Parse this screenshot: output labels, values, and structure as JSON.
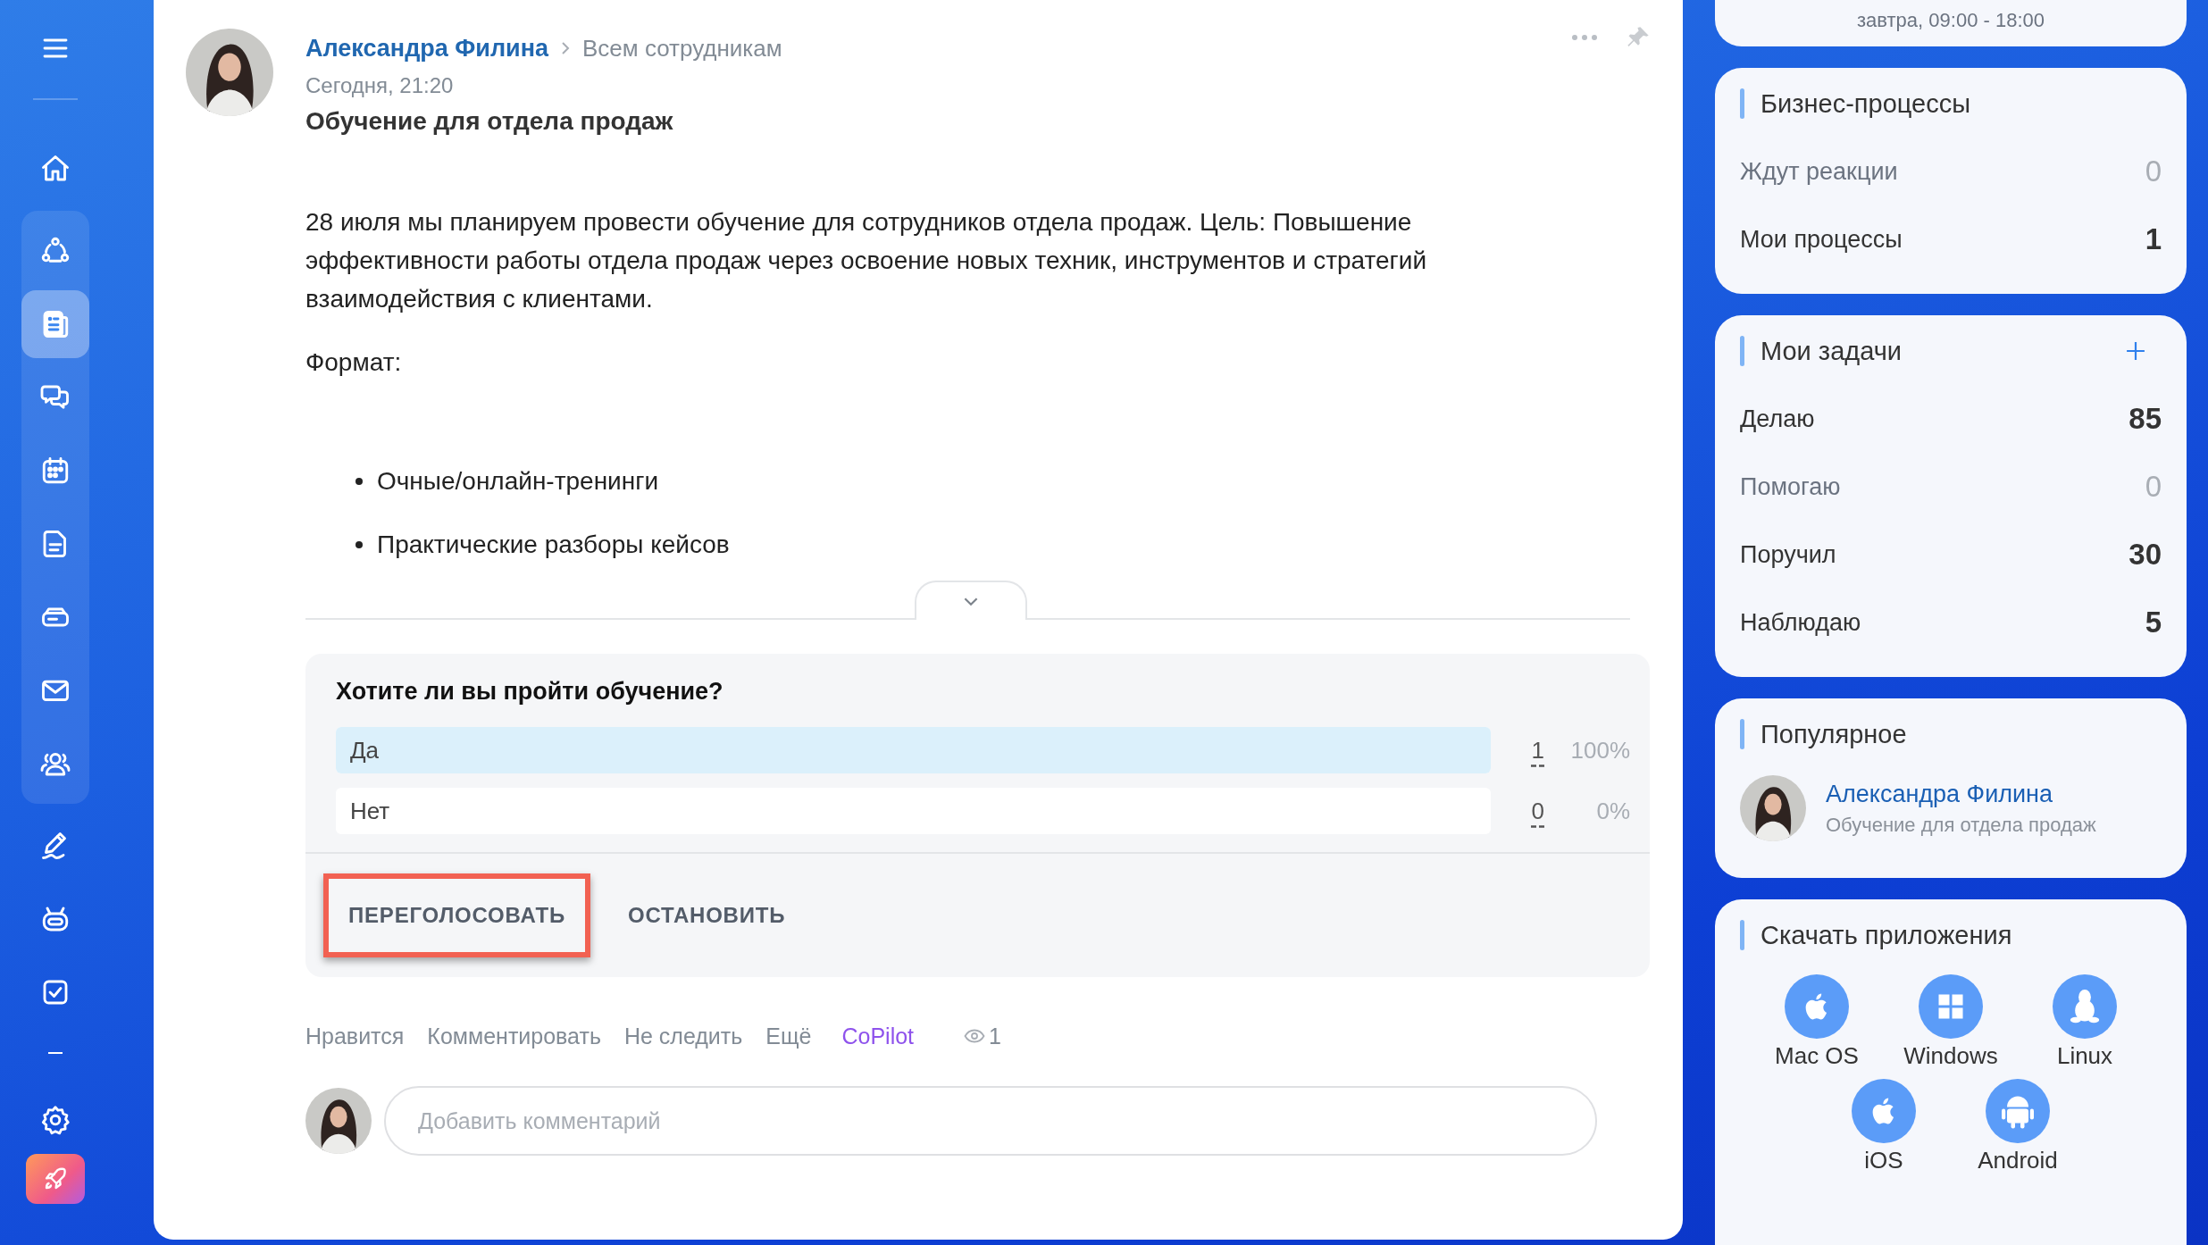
{
  "sidebar": {
    "items_before": [
      {
        "selected": false
      }
    ],
    "group": [
      {
        "selected": false
      },
      {
        "selected": true
      },
      {
        "selected": false
      },
      {
        "selected": false
      },
      {
        "selected": false
      },
      {
        "selected": false
      },
      {
        "selected": false
      },
      {
        "selected": false
      }
    ],
    "items_after": [
      {
        "selected": false
      },
      {
        "selected": false
      },
      {
        "selected": false
      }
    ]
  },
  "post": {
    "author": "Александра Филина",
    "audience": "Всем сотрудникам",
    "time": "Сегодня, 21:20",
    "title": "Обучение для отдела продаж",
    "paragraphs": [
      "28 июля мы планируем провести обучение для сотрудников отдела продаж. Цель: Повышение эффективности работы отдела продаж через освоение новых техник, инструментов и стратегий взаимодействия с клиентами.",
      "Формат:"
    ],
    "bullets": [
      "Очные/онлайн-тренинги",
      "Практические разборы кейсов"
    ],
    "poll": {
      "question": "Хотите ли вы пройти обучение?",
      "options": [
        {
          "label": "Да",
          "votes": "1",
          "percent": "100%",
          "level": 1
        },
        {
          "label": "Нет",
          "votes": "0",
          "percent": "0%",
          "level": 0
        }
      ],
      "buttons": [
        {
          "label": "ПЕРЕГОЛОСОВАТЬ",
          "highlighted": true
        },
        {
          "label": "ОСТАНОВИТЬ",
          "highlighted": false
        }
      ]
    },
    "actions": [
      {
        "label": "Нравится",
        "kind": "plain"
      },
      {
        "label": "Комментировать",
        "kind": "plain"
      },
      {
        "label": "Не следить",
        "kind": "plain"
      },
      {
        "label": "Ещё",
        "kind": "plain"
      },
      {
        "label": "CoPilot",
        "kind": "accent"
      }
    ],
    "views": "1",
    "comment": {
      "placeholder": "Добавить комментарий"
    }
  },
  "widgets": {
    "schedule": {
      "text": "завтра, 09:00 - 18:00"
    },
    "business_processes": {
      "title": "Бизнес-процессы",
      "rows": [
        {
          "label": "Ждут реакции",
          "count": "0",
          "muted": true
        },
        {
          "label": "Мои процессы",
          "count": "1",
          "muted": false
        }
      ]
    },
    "tasks": {
      "title": "Мои задачи",
      "rows": [
        {
          "label": "Делаю",
          "count": "85",
          "muted": false
        },
        {
          "label": "Помогаю",
          "count": "0",
          "muted": true
        },
        {
          "label": "Поручил",
          "count": "30",
          "muted": false
        },
        {
          "label": "Наблюдаю",
          "count": "5",
          "muted": false
        }
      ]
    },
    "popular": {
      "title": "Популярное",
      "items": [
        {
          "author": "Александра Филина",
          "title": "Обучение для отдела продаж"
        }
      ]
    },
    "apps": {
      "title": "Скачать приложения",
      "items": [
        {
          "label": "Mac OS"
        },
        {
          "label": "Windows"
        },
        {
          "label": "Linux"
        },
        {
          "label": "iOS"
        },
        {
          "label": "Android"
        }
      ]
    }
  }
}
